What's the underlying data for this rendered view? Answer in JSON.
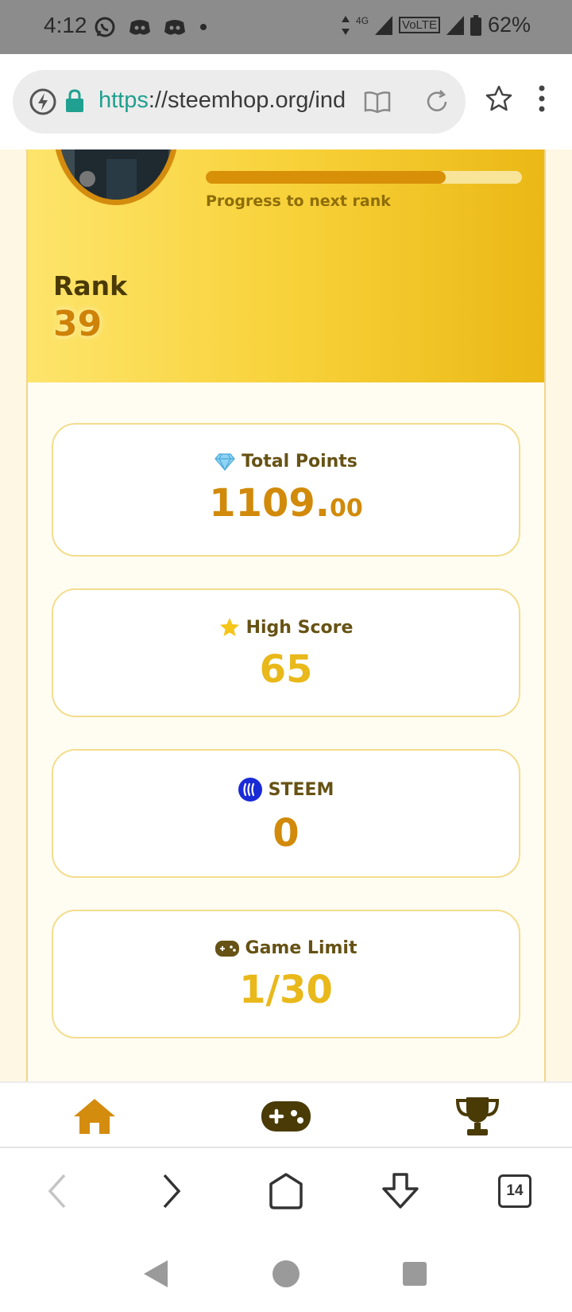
{
  "status_bar": {
    "time": "4:12",
    "network_label": "4G",
    "volte_label": "VoLTE",
    "battery_percent": "62%"
  },
  "browser": {
    "url_scheme": "https",
    "url_rest": "://steemhop.org/ind",
    "tab_count": "14"
  },
  "profile": {
    "progress_fraction": 0.76,
    "progress_label": "Progress to next rank",
    "rank_label": "Rank",
    "rank_value": "39"
  },
  "stats": [
    {
      "icon": "gem-icon",
      "title": "Total Points",
      "value_int": "1109.",
      "value_dec": "00",
      "color": "#d18a0a"
    },
    {
      "icon": "star-icon",
      "title": "High Score",
      "value_int": "65",
      "value_dec": "",
      "color": "#e9b81a"
    },
    {
      "icon": "steem-icon",
      "title": "STEEM",
      "value_int": "0",
      "value_dec": "",
      "color": "#d18a0a"
    },
    {
      "icon": "gamepad-icon",
      "title": "Game Limit",
      "value_int": "1/30",
      "value_dec": "",
      "color": "#e9b81a"
    }
  ],
  "app_nav": {
    "items": [
      "home-icon",
      "gamepad-icon",
      "trophy-icon"
    ],
    "active_color": "#d48c0e",
    "inactive_color": "#4a3a06"
  }
}
